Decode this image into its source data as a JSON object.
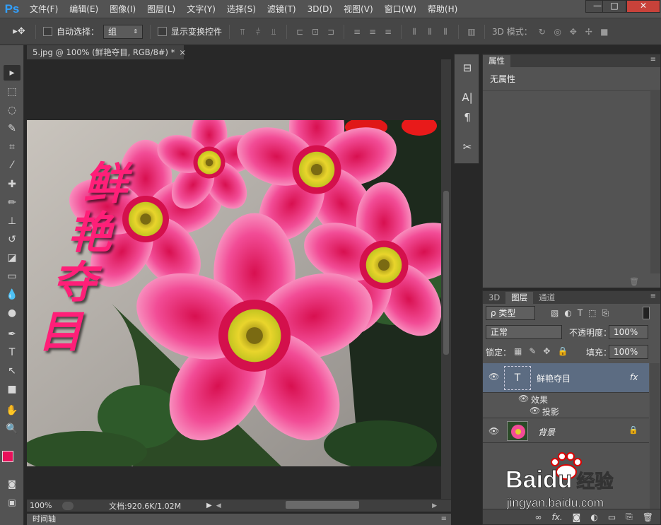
{
  "app": {
    "logo": "Ps"
  },
  "menu": [
    "文件(F)",
    "编辑(E)",
    "图像(I)",
    "图层(L)",
    "文字(Y)",
    "选择(S)",
    "滤镜(T)",
    "3D(D)",
    "视图(V)",
    "窗口(W)",
    "帮助(H)"
  ],
  "window_controls": {
    "minimize": "—",
    "restore": "□",
    "close": "✕"
  },
  "options": {
    "auto_select_label": "自动选择：",
    "auto_select_value": "组",
    "show_transform_label": "显示变换控件",
    "mode_3d_label": "3D 模式："
  },
  "document": {
    "tab_title": "5.jpg @ 100% (鲜艳夺目, RGB/8#) *",
    "tab_close": "×",
    "canvas_text": [
      "鲜",
      "艳",
      "夺",
      "目"
    ]
  },
  "status": {
    "zoom": "100%",
    "doc_info": "文档:920.6K/1.02M"
  },
  "timeline": {
    "label": "时间轴"
  },
  "properties": {
    "tab": "属性",
    "content": "无属性"
  },
  "layers_panel": {
    "tabs": [
      "3D",
      "图层",
      "通道"
    ],
    "active_tab": "图层",
    "filter_label": "ρ 类型",
    "blend_mode": "正常",
    "opacity_label": "不透明度：",
    "opacity_value": "100%",
    "lock_label": "锁定：",
    "fill_label": "填充：",
    "fill_value": "100%",
    "layers": [
      {
        "name": "鲜艳夺目",
        "fx": "fx",
        "selected": true
      },
      {
        "name": "背景",
        "locked": true
      }
    ],
    "effects_label": "效果",
    "effect_item": "投影",
    "bottom_icons": [
      "link-icon",
      "fx",
      "mask",
      "adjustment",
      "folder",
      "new-layer",
      "trash"
    ]
  },
  "colors": {
    "foreground": "#e8105a",
    "background": "#ffffff",
    "text_pink": "#ff1f78"
  },
  "watermark": {
    "brand": "Bai",
    "brand_2": "du",
    "brand_cn": "经验",
    "url": "jingyan.baidu.com"
  }
}
